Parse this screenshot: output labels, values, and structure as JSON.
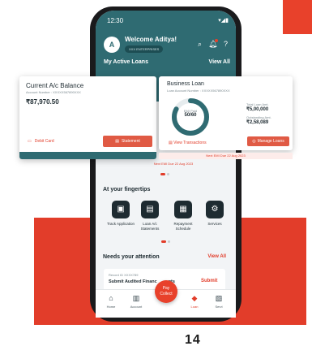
{
  "status_bar": {
    "time": "12:30",
    "icons": "▾◢▮"
  },
  "header": {
    "avatar_letter": "A",
    "welcome": "Welcome Aditya!",
    "company": "XXX ENTERPRISES",
    "icons": [
      "search-icon",
      "bell-icon",
      "help-icon"
    ],
    "section_title": "My Active Loans",
    "view_all": "View All"
  },
  "current_account_card": {
    "title": "Current A/c Balance",
    "account_number": "Account Number : XXXXX567890XXX",
    "balance": "₹87,970.50",
    "debit_card": "Debit Card",
    "statement": "Statement"
  },
  "business_loan_card": {
    "title": "Business Loan",
    "account_number": "Loan Account Number : XXXXX567890XXX",
    "emi_label": "EMI Paid",
    "emi_value": "50/60",
    "emi_progress": 0.83,
    "total_loan_label": "Total Loan Amt.",
    "total_loan_value": "₹5,00,000",
    "outstanding_label": "Outstanding Amt.",
    "outstanding_value": "₹2,58,089",
    "view_transactions": "View Transactions",
    "manage_loans": "Manage Loans",
    "next_emi": "Next EMI Due 22 Aug 2023"
  },
  "screen_next_emi": "Next EMI Due 22 Aug 2023",
  "fingertips": {
    "title": "At your fingertips",
    "tiles": [
      {
        "icon": "track-icon",
        "label": "Track Application"
      },
      {
        "icon": "statement-icon",
        "label": "Loan A/c Statements"
      },
      {
        "icon": "calendar-icon",
        "label": "Repayment Schedule"
      },
      {
        "icon": "services-icon",
        "label": "Services"
      }
    ]
  },
  "attention": {
    "title": "Needs your attention",
    "view_all": "View All",
    "ref": "Record ID XXXX789",
    "text": "Submit Audited Financ",
    "text_tail": "nts",
    "action": "Submit"
  },
  "bottom_nav": {
    "items": [
      "Home",
      "Account",
      "Loan",
      "Servi"
    ],
    "pay_label": [
      "Pay",
      "Collect"
    ]
  },
  "page_number": "14",
  "colors": {
    "brand_red": "#e8412b",
    "teal": "#2f6b72",
    "dark": "#1e2b31"
  }
}
